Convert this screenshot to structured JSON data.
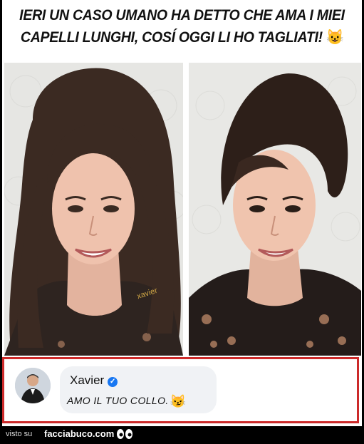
{
  "meme": {
    "title_line1": "IERI UN CASO UMANO HA DETTO CHE AMA I MIEI",
    "title_line2": "CAPELLI LUNGHI, COSÍ OGGI LI HO TAGLIATI!",
    "title_emoji": "😺",
    "left_photo_alt": "before",
    "right_photo_alt": "after",
    "watermark": "xavier"
  },
  "comment": {
    "author": "Xavier",
    "verified_badge": "✓",
    "text": "AMO IL TUO COLLO.",
    "emoji": "😼"
  },
  "footer": {
    "prefix": "visto su",
    "site": "facciabuco.com",
    "icon": "eyes-icon"
  },
  "colors": {
    "comment_border": "#cc2a2a",
    "verified": "#1877f2",
    "footer_bg": "#000000"
  }
}
